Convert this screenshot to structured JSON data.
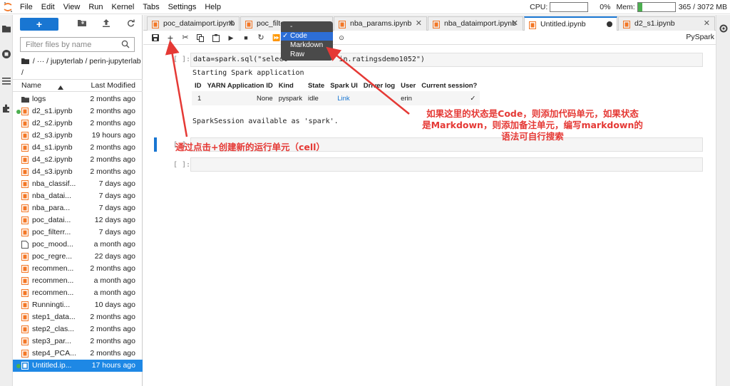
{
  "menubar": {
    "items": [
      "File",
      "Edit",
      "View",
      "Run",
      "Kernel",
      "Tabs",
      "Settings",
      "Help"
    ],
    "cpu_label": "CPU:",
    "cpu_value": "0%",
    "cpu_fraction": 0.0,
    "mem_label": "Mem:",
    "mem_value": "365 / 3072 MB",
    "mem_fraction": 0.12
  },
  "filebrowser": {
    "new_label": "+",
    "filter_placeholder": "Filter files by name",
    "breadcrumb": "/ ··· / jupyterlab / perin-jupyterlab /",
    "header_name": "Name",
    "header_modified": "Last Modified",
    "files": [
      {
        "name": "logs",
        "modified": "2 months ago",
        "kind": "folder",
        "running": false
      },
      {
        "name": "d2_s1.ipynb",
        "modified": "2 months ago",
        "kind": "notebook",
        "running": true
      },
      {
        "name": "d2_s2.ipynb",
        "modified": "2 months ago",
        "kind": "notebook",
        "running": false
      },
      {
        "name": "d2_s3.ipynb",
        "modified": "19 hours ago",
        "kind": "notebook",
        "running": false
      },
      {
        "name": "d4_s1.ipynb",
        "modified": "2 months ago",
        "kind": "notebook",
        "running": false
      },
      {
        "name": "d4_s2.ipynb",
        "modified": "2 months ago",
        "kind": "notebook",
        "running": false
      },
      {
        "name": "d4_s3.ipynb",
        "modified": "2 months ago",
        "kind": "notebook",
        "running": false
      },
      {
        "name": "nba_classif...",
        "modified": "7 days ago",
        "kind": "notebook",
        "running": false
      },
      {
        "name": "nba_datai...",
        "modified": "7 days ago",
        "kind": "notebook",
        "running": false
      },
      {
        "name": "nba_para...",
        "modified": "7 days ago",
        "kind": "notebook",
        "running": false
      },
      {
        "name": "poc_datai...",
        "modified": "12 days ago",
        "kind": "notebook",
        "running": false
      },
      {
        "name": "poc_filterr...",
        "modified": "7 days ago",
        "kind": "notebook",
        "running": false
      },
      {
        "name": "poc_mood...",
        "modified": "a month ago",
        "kind": "file",
        "running": false
      },
      {
        "name": "poc_regre...",
        "modified": "22 days ago",
        "kind": "notebook",
        "running": false
      },
      {
        "name": "recommen...",
        "modified": "2 months ago",
        "kind": "notebook",
        "running": false
      },
      {
        "name": "recommen...",
        "modified": "a month ago",
        "kind": "notebook",
        "running": false
      },
      {
        "name": "recommen...",
        "modified": "a month ago",
        "kind": "notebook",
        "running": false
      },
      {
        "name": "Runningti...",
        "modified": "10 days ago",
        "kind": "notebook",
        "running": false
      },
      {
        "name": "step1_data...",
        "modified": "2 months ago",
        "kind": "notebook",
        "running": false
      },
      {
        "name": "step2_clas...",
        "modified": "2 months ago",
        "kind": "notebook",
        "running": false
      },
      {
        "name": "step3_par...",
        "modified": "2 months ago",
        "kind": "notebook",
        "running": false
      },
      {
        "name": "step4_PCA...",
        "modified": "2 months ago",
        "kind": "notebook",
        "running": false
      },
      {
        "name": "Untitled.ip...",
        "modified": "17 hours ago",
        "kind": "notebook",
        "running": true,
        "selected": true
      }
    ]
  },
  "tabs": [
    {
      "label": "poc_dataimport.ipynb",
      "active": false
    },
    {
      "label": "poc_filte",
      "active": false
    },
    {
      "label": "nba_params.ipynb",
      "active": false
    },
    {
      "label": "nba_dataimport.ipynb",
      "active": false
    },
    {
      "label": "Untitled.ipynb",
      "active": true
    },
    {
      "label": "d2_s1.ipynb",
      "active": false
    }
  ],
  "nb_toolbar": {
    "kernel": "PySpark"
  },
  "cells": {
    "cell1_prompt": "[ ]:",
    "cell1_code_prefix": "data=spark.sql(\"select",
    "cell1_code_suffix": "in.ratingsdemo1052\")",
    "output_starting": "Starting Spark application",
    "table_headers": [
      "ID",
      "YARN Application ID",
      "Kind",
      "State",
      "Spark UI",
      "Driver log",
      "User",
      "Current session?"
    ],
    "table_row": [
      "1",
      "None",
      "pyspark",
      "idle",
      "Link",
      "",
      "erin",
      "✓"
    ],
    "output_session": "SparkSession available as 'spark'.",
    "cell2_prompt": "[ ]:",
    "cell3_prompt": "[ ]:"
  },
  "dropdown": {
    "items": [
      "-",
      "Code",
      "Markdown",
      "Raw"
    ],
    "selected": "Code",
    "check": "✓"
  },
  "annotations": {
    "right_line1": "如果这里的状态是Code，则添加代码单元，如果状态",
    "right_line2": "是Markdown，则添加备注单元，编写markdown的",
    "right_line3": "语法可自行搜索",
    "left_note": "通过点击+创建新的运行单元（cell）"
  },
  "colors": {
    "accent": "#1976d2",
    "annotation": "#e53935",
    "notebook_icon": "#f37726",
    "kernel_dot": "#4caf50"
  }
}
